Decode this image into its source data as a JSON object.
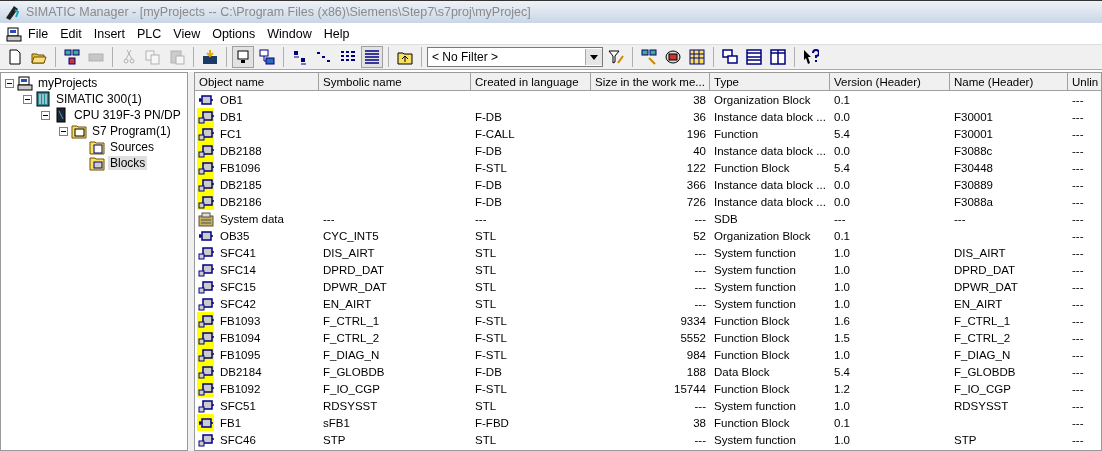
{
  "window": {
    "title": "SIMATIC Manager - [myProjects -- C:\\Program Files (x86)\\Siemens\\Step7\\s7proj\\myProjec]"
  },
  "menu": [
    "File",
    "Edit",
    "Insert",
    "PLC",
    "View",
    "Options",
    "Window",
    "Help"
  ],
  "toolbar": [
    {
      "kind": "new",
      "disabled": false,
      "pressed": false
    },
    {
      "kind": "open",
      "disabled": false,
      "pressed": false
    },
    {
      "kind": "sep"
    },
    {
      "kind": "nodes",
      "disabled": false,
      "pressed": false
    },
    {
      "kind": "memcard",
      "disabled": true,
      "pressed": false
    },
    {
      "kind": "sep"
    },
    {
      "kind": "cut",
      "disabled": true,
      "pressed": false
    },
    {
      "kind": "copy",
      "disabled": true,
      "pressed": false
    },
    {
      "kind": "paste",
      "disabled": true,
      "pressed": false
    },
    {
      "kind": "sep"
    },
    {
      "kind": "download",
      "disabled": false,
      "pressed": false
    },
    {
      "kind": "sep"
    },
    {
      "kind": "offline",
      "disabled": false,
      "pressed": true
    },
    {
      "kind": "online",
      "disabled": false,
      "pressed": false
    },
    {
      "kind": "sep"
    },
    {
      "kind": "large",
      "disabled": false,
      "pressed": false
    },
    {
      "kind": "small",
      "disabled": false,
      "pressed": false
    },
    {
      "kind": "list",
      "disabled": false,
      "pressed": false
    },
    {
      "kind": "details",
      "disabled": false,
      "pressed": true
    },
    {
      "kind": "sep"
    },
    {
      "kind": "up",
      "disabled": false,
      "pressed": false
    },
    {
      "kind": "sep"
    },
    {
      "kind": "filter",
      "value": "< No Filter >"
    },
    {
      "kind": "filteredit",
      "disabled": false,
      "pressed": false
    },
    {
      "kind": "sep"
    },
    {
      "kind": "symbols",
      "disabled": false,
      "pressed": false
    },
    {
      "kind": "diag",
      "disabled": false,
      "pressed": false
    },
    {
      "kind": "config",
      "disabled": false,
      "pressed": false
    },
    {
      "kind": "sep"
    },
    {
      "kind": "cascade",
      "disabled": false,
      "pressed": false
    },
    {
      "kind": "tileh",
      "disabled": false,
      "pressed": false
    },
    {
      "kind": "tilev",
      "disabled": false,
      "pressed": false
    },
    {
      "kind": "sep"
    },
    {
      "kind": "help",
      "disabled": false,
      "pressed": false
    }
  ],
  "tree": [
    {
      "label": "myProjects",
      "kind": "project",
      "expanded": true,
      "selected": false,
      "children": [
        {
          "label": "SIMATIC 300(1)",
          "kind": "station",
          "expanded": true,
          "selected": false,
          "children": [
            {
              "label": "CPU 319F-3 PN/DP",
              "kind": "cpu",
              "expanded": true,
              "selected": false,
              "children": [
                {
                  "label": "S7 Program(1)",
                  "kind": "program",
                  "expanded": true,
                  "selected": false,
                  "children": [
                    {
                      "label": "Sources",
                      "kind": "sources",
                      "selected": false
                    },
                    {
                      "label": "Blocks",
                      "kind": "blocks",
                      "selected": true
                    }
                  ]
                }
              ]
            }
          ]
        }
      ]
    }
  ],
  "table": {
    "columns": [
      "Object name",
      "Symbolic name",
      "Created in language",
      "Size in the work me...",
      "Type",
      "Version (Header)",
      "Name (Header)",
      "Unlin"
    ],
    "rows": [
      {
        "kind": "ob",
        "safety": false,
        "name": "OB1",
        "size": "38",
        "type": "Organization Block",
        "version": "0.1",
        "unlinked": "---"
      },
      {
        "kind": "block",
        "safety": true,
        "name": "DB1",
        "language": "F-DB",
        "size": "36",
        "type": "Instance data block ...",
        "version": "0.0",
        "header_name": "F30001",
        "unlinked": "---"
      },
      {
        "kind": "block",
        "safety": true,
        "name": "FC1",
        "language": "F-CALL",
        "size": "196",
        "type": "Function",
        "version": "5.4",
        "header_name": "F30001",
        "unlinked": "---"
      },
      {
        "kind": "block",
        "safety": true,
        "name": "DB2188",
        "language": "F-DB",
        "size": "40",
        "type": "Instance data block ...",
        "version": "0.0",
        "header_name": "F3088c",
        "unlinked": "---"
      },
      {
        "kind": "block",
        "safety": true,
        "name": "FB1096",
        "language": "F-STL",
        "size": "122",
        "type": "Function Block",
        "version": "5.4",
        "header_name": "F30448",
        "unlinked": "---"
      },
      {
        "kind": "block",
        "safety": true,
        "name": "DB2185",
        "language": "F-DB",
        "size": "366",
        "type": "Instance data block ...",
        "version": "0.0",
        "header_name": "F30889",
        "unlinked": "---"
      },
      {
        "kind": "block",
        "safety": true,
        "name": "DB2186",
        "language": "F-DB",
        "size": "726",
        "type": "Instance data block ...",
        "version": "0.0",
        "header_name": "F3088a",
        "unlinked": "---"
      },
      {
        "kind": "sysdata",
        "safety": false,
        "name": "System data",
        "symbolic": "---",
        "language": "---",
        "size": "---",
        "type": "SDB",
        "version": "---",
        "header_name": "---",
        "unlinked": "---"
      },
      {
        "kind": "ob",
        "safety": false,
        "name": "OB35",
        "symbolic": "CYC_INT5",
        "language": "STL",
        "size": "52",
        "type": "Organization Block",
        "version": "0.1",
        "unlinked": "---"
      },
      {
        "kind": "block",
        "safety": false,
        "name": "SFC41",
        "symbolic": "DIS_AIRT",
        "language": "STL",
        "size": "---",
        "type": "System function",
        "version": "1.0",
        "header_name": "DIS_AIRT",
        "unlinked": "---"
      },
      {
        "kind": "block",
        "safety": false,
        "name": "SFC14",
        "symbolic": "DPRD_DAT",
        "language": "STL",
        "size": "---",
        "type": "System function",
        "version": "1.0",
        "header_name": "DPRD_DAT",
        "unlinked": "---"
      },
      {
        "kind": "block",
        "safety": false,
        "name": "SFC15",
        "symbolic": "DPWR_DAT",
        "language": "STL",
        "size": "---",
        "type": "System function",
        "version": "1.0",
        "header_name": "DPWR_DAT",
        "unlinked": "---"
      },
      {
        "kind": "block",
        "safety": false,
        "name": "SFC42",
        "symbolic": "EN_AIRT",
        "language": "STL",
        "size": "---",
        "type": "System function",
        "version": "1.0",
        "header_name": "EN_AIRT",
        "unlinked": "---"
      },
      {
        "kind": "block",
        "safety": true,
        "name": "FB1093",
        "symbolic": "F_CTRL_1",
        "language": "F-STL",
        "size": "9334",
        "type": "Function Block",
        "version": "1.6",
        "header_name": "F_CTRL_1",
        "unlinked": "---"
      },
      {
        "kind": "block",
        "safety": true,
        "name": "FB1094",
        "symbolic": "F_CTRL_2",
        "language": "F-STL",
        "size": "5552",
        "type": "Function Block",
        "version": "1.5",
        "header_name": "F_CTRL_2",
        "unlinked": "---"
      },
      {
        "kind": "block",
        "safety": true,
        "name": "FB1095",
        "symbolic": "F_DIAG_N",
        "language": "F-STL",
        "size": "984",
        "type": "Function Block",
        "version": "1.0",
        "header_name": "F_DIAG_N",
        "unlinked": "---"
      },
      {
        "kind": "block",
        "safety": true,
        "name": "DB2184",
        "symbolic": "F_GLOBDB",
        "language": "F-DB",
        "size": "188",
        "type": "Data Block",
        "version": "5.4",
        "header_name": "F_GLOBDB",
        "unlinked": "---"
      },
      {
        "kind": "block",
        "safety": true,
        "name": "FB1092",
        "symbolic": "F_IO_CGP",
        "language": "F-STL",
        "size": "15744",
        "type": "Function Block",
        "version": "1.2",
        "header_name": "F_IO_CGP",
        "unlinked": "---"
      },
      {
        "kind": "block",
        "safety": false,
        "name": "SFC51",
        "symbolic": "RDSYSST",
        "language": "STL",
        "size": "---",
        "type": "System function",
        "version": "1.0",
        "header_name": "RDSYSST",
        "unlinked": "---"
      },
      {
        "kind": "ob",
        "safety": true,
        "name": "FB1",
        "symbolic": "sFB1",
        "language": "F-FBD",
        "size": "38",
        "type": "Function Block",
        "version": "0.1",
        "unlinked": "---"
      },
      {
        "kind": "block",
        "safety": false,
        "name": "SFC46",
        "symbolic": "STP",
        "language": "STL",
        "size": "---",
        "type": "System function",
        "version": "1.0",
        "header_name": "STP",
        "unlinked": "---"
      }
    ]
  }
}
